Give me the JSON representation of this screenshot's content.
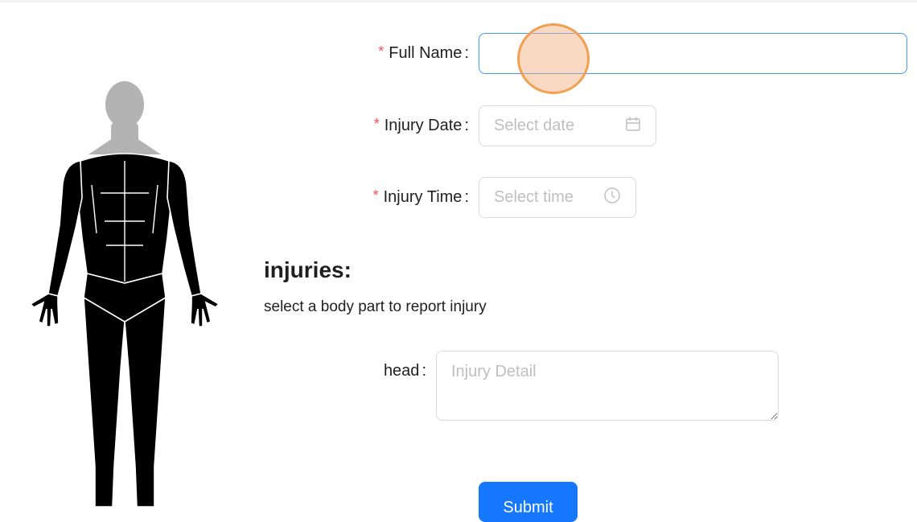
{
  "form": {
    "full_name": {
      "required_mark": "*",
      "label": "Full Name",
      "colon": ":",
      "value": "",
      "placeholder": ""
    },
    "injury_date": {
      "required_mark": "*",
      "label": "Injury Date",
      "colon": ":",
      "placeholder": "Select date",
      "icon": "calendar-icon"
    },
    "injury_time": {
      "required_mark": "*",
      "label": "Injury Time",
      "colon": ":",
      "placeholder": "Select time",
      "icon": "clock-icon"
    }
  },
  "injuries": {
    "heading": "injuries:",
    "subtext": "select a body part to report injury",
    "fields": [
      {
        "label": "head",
        "colon": ":",
        "placeholder": "Injury Detail",
        "value": ""
      }
    ]
  },
  "submit_label": "Submit",
  "colors": {
    "required": "#ff4d4f",
    "primary": "#1677ff",
    "focus_border": "#4096ff",
    "body_dark": "#000000",
    "head_gray": "#b3b3b3",
    "cursor": "#f0a050"
  }
}
